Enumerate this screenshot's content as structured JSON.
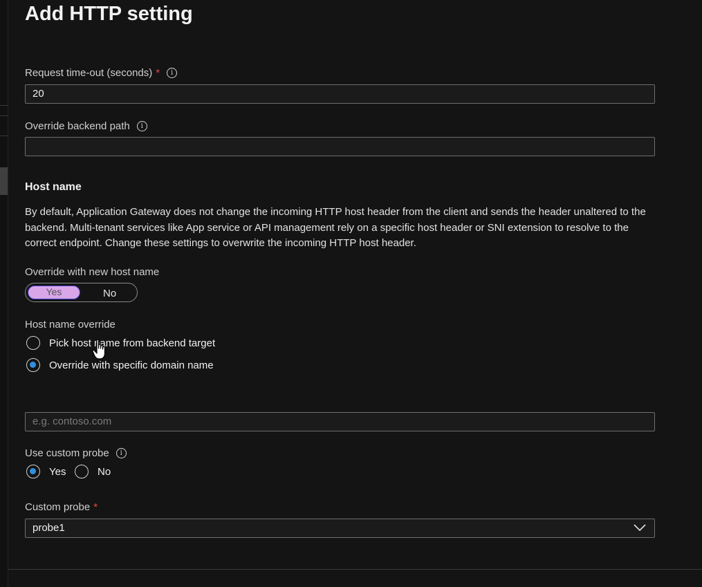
{
  "page": {
    "title": "Add HTTP setting"
  },
  "request_timeout": {
    "label": "Request time-out (seconds)",
    "required_marker": "*",
    "value": "20"
  },
  "override_backend_path": {
    "label": "Override backend path",
    "value": ""
  },
  "host_name": {
    "heading": "Host name",
    "description": "By default, Application Gateway does not change the incoming HTTP host header from the client and sends the header unaltered to the backend. Multi-tenant services like App service or API management rely on a specific host header or SNI extension to resolve to the correct endpoint. Change these settings to overwrite the incoming HTTP host header.",
    "override_label": "Override with new host name",
    "toggle_yes": "Yes",
    "toggle_no": "No",
    "toggle_selected": "Yes",
    "override_mode_label": "Host name override",
    "option_pick": "Pick host name from backend target",
    "option_specific": "Override with specific domain name",
    "selected_option": "Override with specific domain name",
    "domain_placeholder": "e.g. contoso.com"
  },
  "custom_probe_toggle": {
    "label": "Use custom probe",
    "yes": "Yes",
    "no": "No",
    "selected": "Yes"
  },
  "custom_probe": {
    "label": "Custom probe",
    "required_marker": "*",
    "selected_value": "probe1"
  },
  "colors": {
    "accent": "#2f8fe0",
    "toggle_selected_bg": "#d9a6e8",
    "required": "#e34c4c"
  },
  "icons": [
    "info-icon",
    "chevron-down-icon",
    "hand-pointer-icon"
  ]
}
